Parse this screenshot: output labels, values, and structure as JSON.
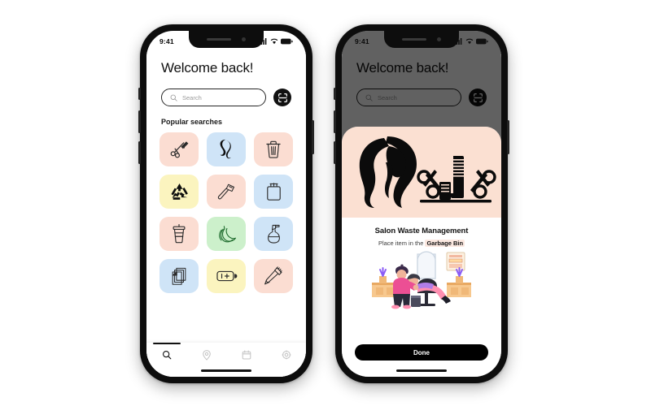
{
  "colors": {
    "accent_peach": "#fbe0d2",
    "tile_pink": "#fbddd2",
    "tile_blue": "#cfe4f7",
    "tile_yellow": "#fbf4bf",
    "tile_green": "#ccf0cb",
    "button_black": "#000000"
  },
  "phone1": {
    "status_bar": {
      "time": "9:41",
      "signal_icon": "cellular-signal-icon",
      "wifi_icon": "wifi-icon",
      "battery_icon": "battery-icon"
    },
    "heading": "Welcome back!",
    "search": {
      "placeholder": "Search",
      "value": "",
      "icon": "search-icon"
    },
    "scan_button": {
      "icon": "scan-frame-icon"
    },
    "section_title": "Popular searches",
    "tiles": [
      {
        "label": "Scissors and comb",
        "icon": "scissors-comb-icon",
        "bg": "#fbddd2"
      },
      {
        "label": "Hair lock",
        "icon": "hair-lock-icon",
        "bg": "#cfe4f7"
      },
      {
        "label": "Garbage bin",
        "icon": "trash-bin-icon",
        "bg": "#fbddd2"
      },
      {
        "label": "Recycle",
        "icon": "recycle-icon",
        "bg": "#fbf4bf"
      },
      {
        "label": "Razor",
        "icon": "razor-icon",
        "bg": "#fbddd2"
      },
      {
        "label": "Shopping bag",
        "icon": "shopping-bag-icon",
        "bg": "#cfe4f7"
      },
      {
        "label": "Coffee cup",
        "icon": "coffee-cup-icon",
        "bg": "#fbddd2"
      },
      {
        "label": "Bananas",
        "icon": "bananas-icon",
        "bg": "#ccf0cb"
      },
      {
        "label": "Spray bottle",
        "icon": "spray-bottle-icon",
        "bg": "#cfe4f7"
      },
      {
        "label": "Paper stack",
        "icon": "paper-stack-icon",
        "bg": "#cfe4f7"
      },
      {
        "label": "Battery",
        "icon": "battery-cell-icon",
        "bg": "#fbf4bf"
      },
      {
        "label": "Toothbrush",
        "icon": "toothbrush-icon",
        "bg": "#fbddd2"
      }
    ],
    "tabs": [
      {
        "label": "Search",
        "icon": "search-icon",
        "active": true
      },
      {
        "label": "Location",
        "icon": "location-pin-icon",
        "active": false
      },
      {
        "label": "Calendar",
        "icon": "calendar-icon",
        "active": false
      },
      {
        "label": "Settings",
        "icon": "gear-icon",
        "active": false
      }
    ]
  },
  "phone2": {
    "status_bar": {
      "time": "9:41",
      "signal_icon": "cellular-signal-icon",
      "wifi_icon": "wifi-icon",
      "battery_icon": "battery-icon"
    },
    "heading": "Welcome back!",
    "search": {
      "placeholder": "Search",
      "value": "",
      "icon": "search-icon"
    },
    "scan_button": {
      "icon": "scan-frame-icon"
    },
    "modal": {
      "hero_icon": "salon-hair-scissors-comb-illustration",
      "title": "Salon Waste Management",
      "subtitle_prefix": "Place item in the ",
      "subtitle_highlight": "Garbage Bin",
      "illustration": "hair-salon-stylist-client-illustration",
      "done_label": "Done"
    }
  }
}
